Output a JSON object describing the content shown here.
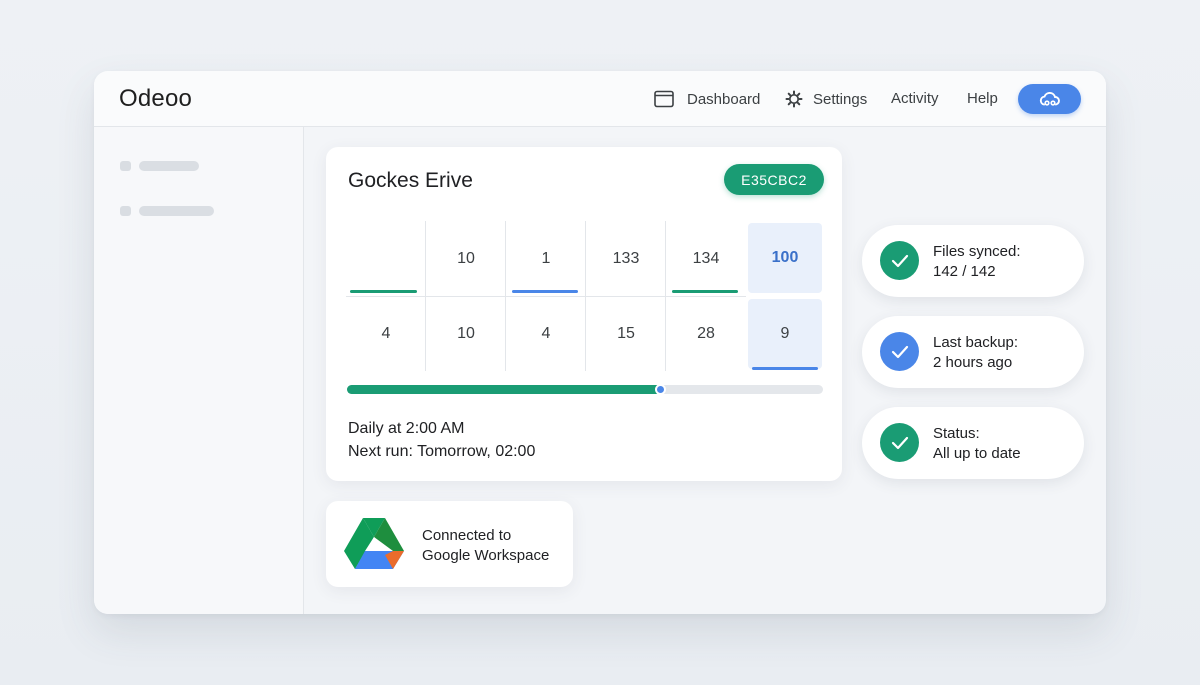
{
  "app": {
    "title": "Odeoo"
  },
  "nav": {
    "dashboard": "Dashboard",
    "settings": "Settings",
    "activity": "Activity",
    "help": "Help",
    "cloud_icon": "cloud-sync-icon"
  },
  "card": {
    "title": "Gockes Erive",
    "tag": "E35CBC2",
    "grid": {
      "row1": [
        "",
        "10",
        "1",
        "133",
        "134",
        "100"
      ],
      "row2": [
        "4",
        "10",
        "4",
        "15",
        "28",
        "9"
      ]
    },
    "progress_percent": 66,
    "schedule": "Daily at 2:00 AM",
    "next_run": "Next run: Tomorrow, 02:00"
  },
  "connection": {
    "line1": "Connected to",
    "line2": "Google Workspace",
    "logo": "google-drive-icon"
  },
  "status": [
    {
      "label": "Files synced:",
      "value": "142 / 142",
      "color": "#1a9c74"
    },
    {
      "label": "Last backup:",
      "value": "2 hours ago",
      "color": "#4a86e8"
    },
    {
      "label": "Status:",
      "value": "All up to date",
      "color": "#1a9c74"
    }
  ],
  "colors": {
    "green": "#1a9c74",
    "blue": "#4a86e8",
    "highlight": "#e9f0fb"
  }
}
